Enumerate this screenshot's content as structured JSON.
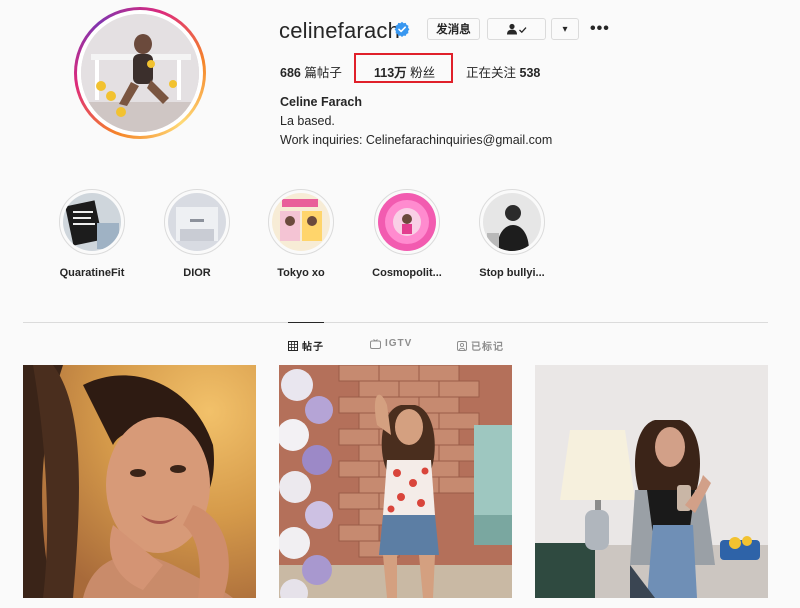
{
  "profile": {
    "username": "celinefarach",
    "buttons": {
      "message": "发消息",
      "following_icon": "person-check-icon",
      "more_caret": "▾"
    },
    "stats": {
      "posts_count": "686",
      "posts_label": "篇帖子",
      "followers_count": "113万",
      "followers_label": "粉丝",
      "following_label": "正在关注",
      "following_count": "538"
    },
    "full_name": "Celine Farach",
    "bio_line1": "La based.",
    "bio_line2": "Work inquiries: Celinefarachinquiries@gmail.com"
  },
  "highlights": [
    {
      "label": "QuaratineFit"
    },
    {
      "label": "DIOR"
    },
    {
      "label": "Tokyo xo"
    },
    {
      "label": "Cosmopolit..."
    },
    {
      "label": "Stop bullyi..."
    }
  ],
  "tabs": [
    {
      "label": "帖子",
      "active": true
    },
    {
      "label": "IGTV",
      "active": false
    },
    {
      "label": "已标记",
      "active": false
    }
  ],
  "colors": {
    "accent_highlight": "#e0202a",
    "verified": "#3897f0",
    "text": "#262626",
    "muted": "#8e8e8e"
  }
}
